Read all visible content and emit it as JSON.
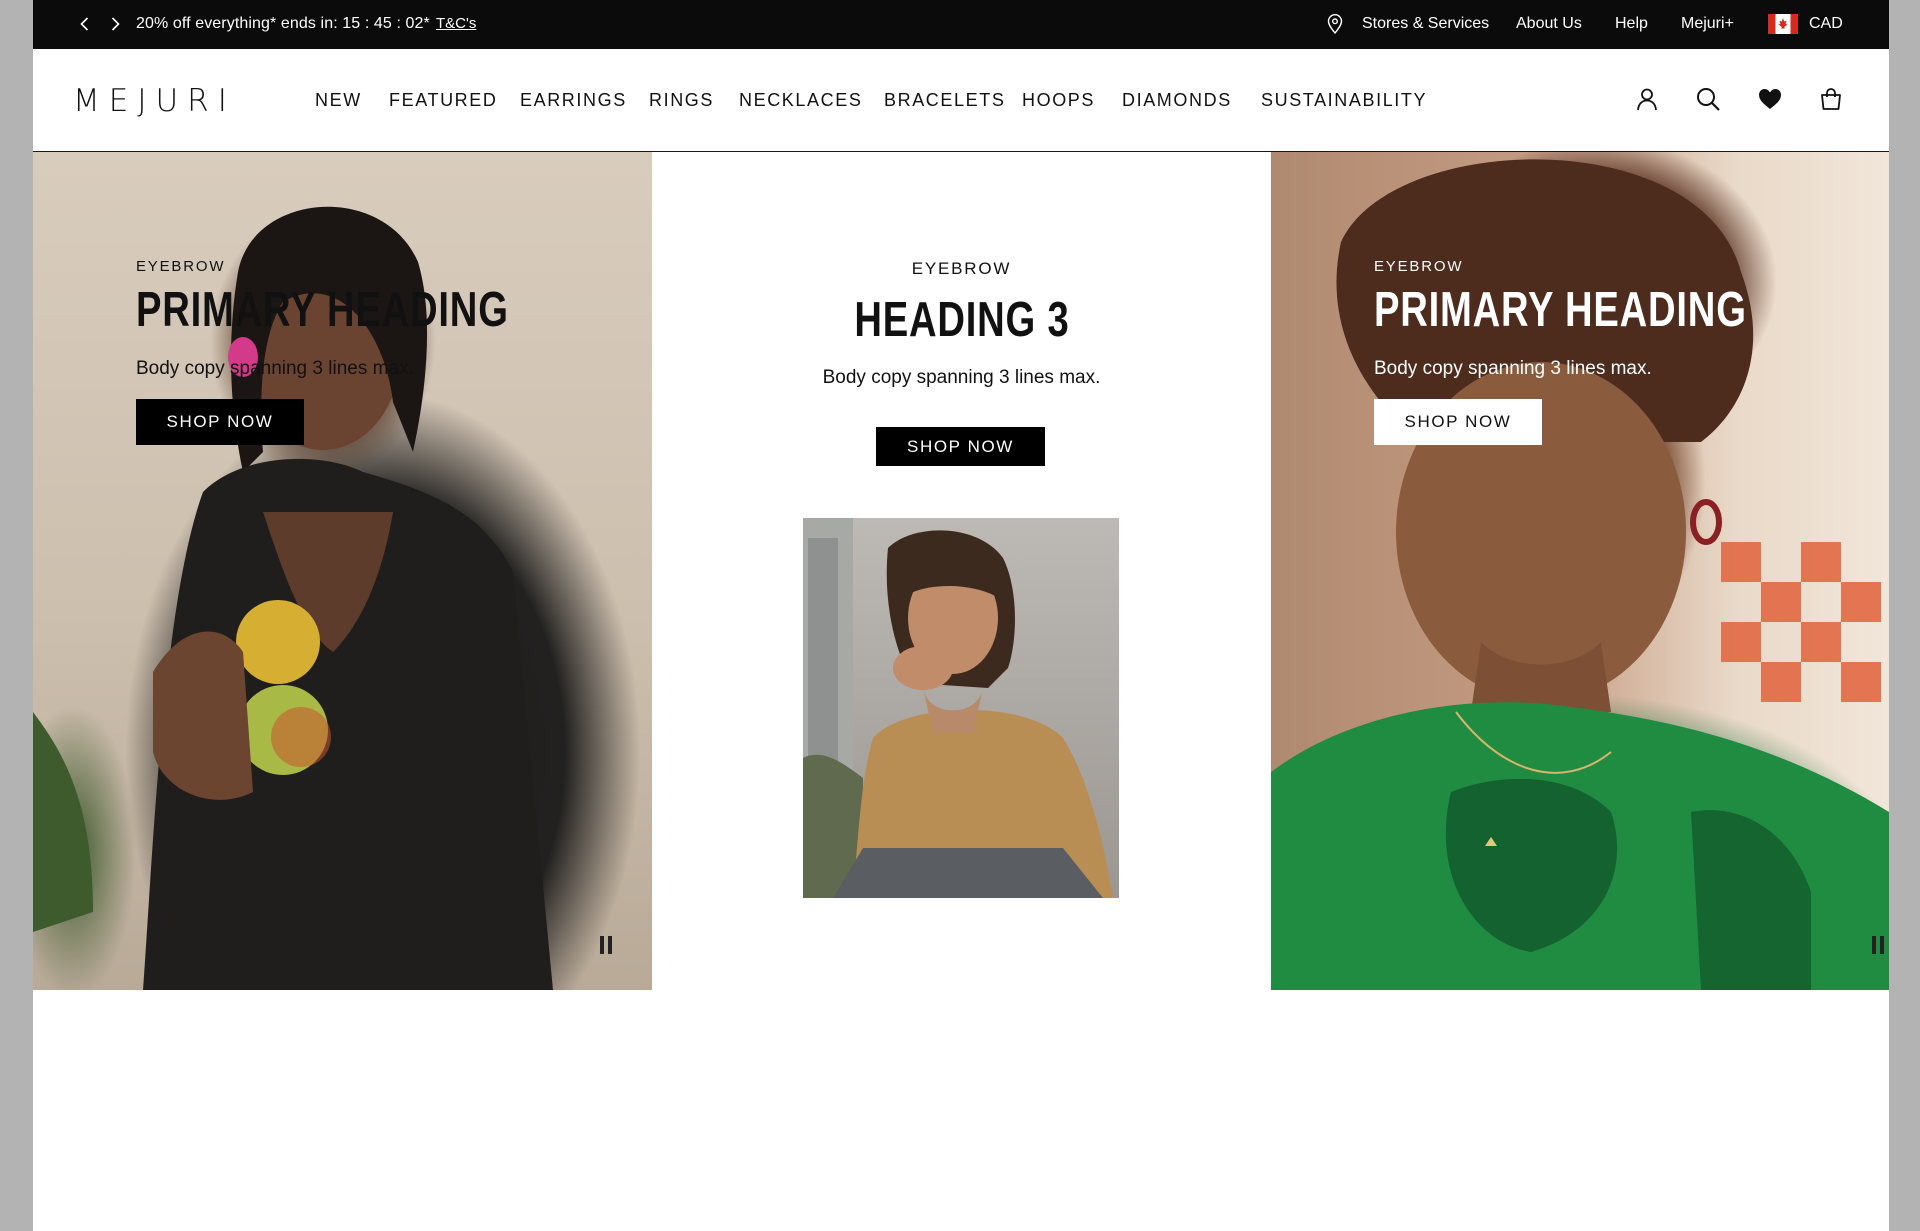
{
  "promo_bar": {
    "message": "20% off everything* ends in: 15 : 45 : 02*",
    "terms_link": "T&C's",
    "links": {
      "stores": "Stores & Services",
      "about": "About Us",
      "help": "Help",
      "membership": "Mejuri+"
    },
    "currency": "CAD",
    "icons": {
      "prev": "chevron-left-icon",
      "next": "chevron-right-icon",
      "location": "map-pin-icon",
      "flag": "canada-flag-icon"
    }
  },
  "header": {
    "logo": "MEJURI",
    "nav": [
      "NEW",
      "FEATURED",
      "EARRINGS",
      "RINGS",
      "NECKLACES",
      "BRACELETS",
      "HOOPS",
      "DIAMONDS",
      "SUSTAINABILITY"
    ],
    "icons": [
      "account-icon",
      "search-icon",
      "wishlist-heart-icon",
      "shopping-bag-icon"
    ]
  },
  "hero": {
    "left": {
      "eyebrow": "EYEBROW",
      "heading": "PRIMARY HEADING",
      "body": "Body copy spanning 3 lines max.",
      "cta": "SHOP NOW"
    },
    "center": {
      "eyebrow": "EYEBROW",
      "heading": "HEADING 3",
      "body": "Body copy spanning 3 lines max.",
      "cta": "SHOP NOW"
    },
    "right": {
      "eyebrow": "EYEBROW",
      "heading": "PRIMARY HEADING",
      "body": "Body copy spanning 3 lines max.",
      "cta": "SHOP NOW"
    }
  },
  "colors": {
    "promo_bg": "#0b0b0b",
    "text": "#111111",
    "button_dark": "#000000",
    "button_light": "#ffffff",
    "page_gutter": "#b3b3b3"
  }
}
